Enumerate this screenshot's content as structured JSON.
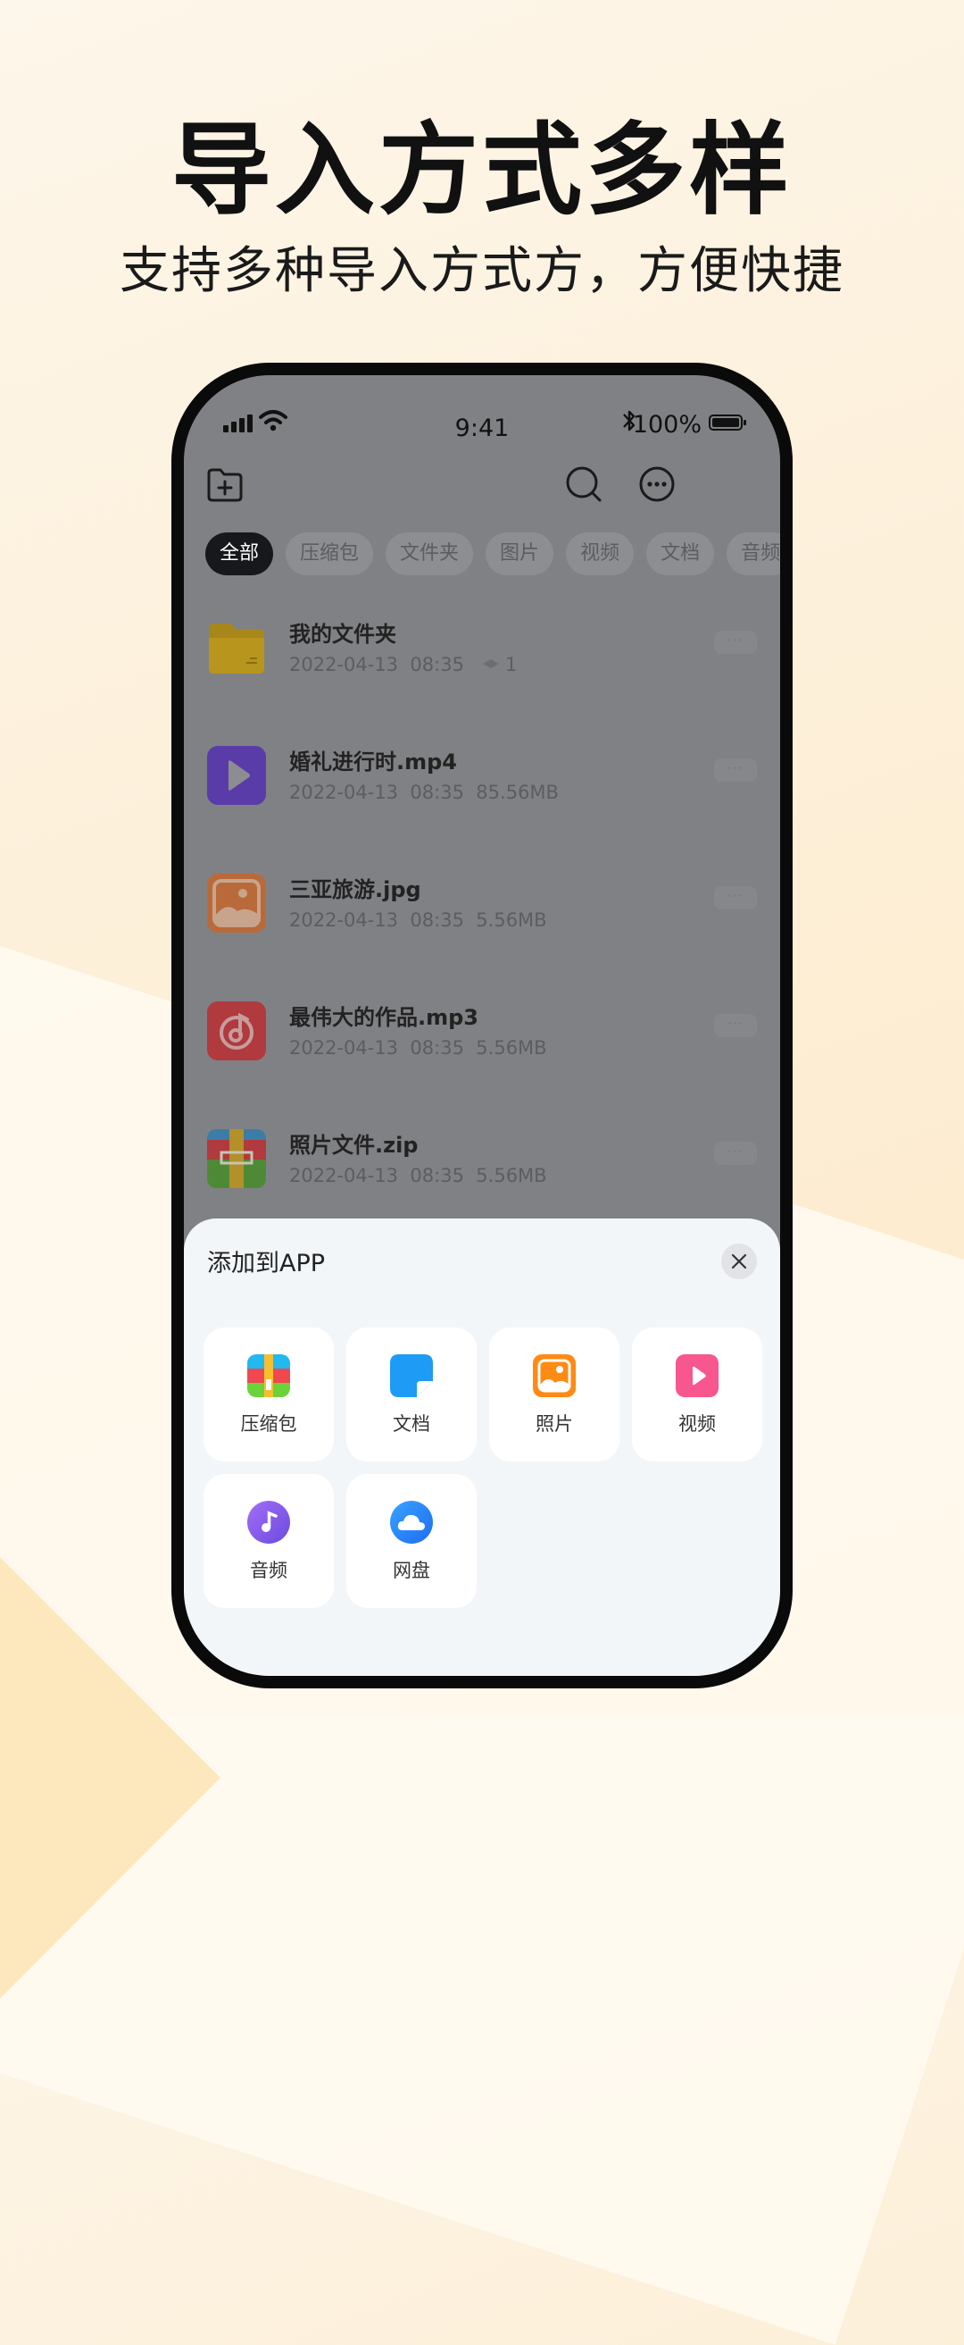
{
  "promo": {
    "headline": "导入方式多样",
    "subline": "支持多种导入方式方，方便快捷"
  },
  "status_bar": {
    "time": "9:41",
    "battery": "100%",
    "icons": [
      "signal-icon",
      "wifi-icon",
      "bluetooth-icon",
      "battery-icon"
    ]
  },
  "toolbar": {
    "icons": [
      "new-folder-icon",
      "search-icon",
      "more-icon"
    ]
  },
  "filters": [
    {
      "label": "全部",
      "active": true
    },
    {
      "label": "压缩包",
      "active": false
    },
    {
      "label": "文件夹",
      "active": false
    },
    {
      "label": "图片",
      "active": false
    },
    {
      "label": "视频",
      "active": false
    },
    {
      "label": "文档",
      "active": false
    },
    {
      "label": "音频",
      "active": false
    }
  ],
  "files": [
    {
      "name": "我的文件夹",
      "date": "2022-04-13",
      "time": "08:35",
      "size": "",
      "count": "1",
      "icon": "folder-icon",
      "color": "#b8951c"
    },
    {
      "name": "婚礼进行时.mp4",
      "date": "2022-04-13",
      "time": "08:35",
      "size": "85.56MB",
      "icon": "video-file-icon",
      "color": "#5a3ca8"
    },
    {
      "name": "三亚旅游.jpg",
      "date": "2022-04-13",
      "time": "08:35",
      "size": "5.56MB",
      "icon": "image-file-icon",
      "color": "#b96a3a"
    },
    {
      "name": "最伟大的作品.mp3",
      "date": "2022-04-13",
      "time": "08:35",
      "size": "5.56MB",
      "icon": "audio-file-icon",
      "color": "#b03a3e"
    },
    {
      "name": "照片文件.zip",
      "date": "2022-04-13",
      "time": "08:35",
      "size": "5.56MB",
      "icon": "zip-file-icon",
      "color": "#3c7da8"
    }
  ],
  "row_more": "···",
  "sheet": {
    "title": "添加到APP",
    "options": [
      {
        "label": "压缩包",
        "icon": "archive-icon"
      },
      {
        "label": "文档",
        "icon": "document-icon"
      },
      {
        "label": "照片",
        "icon": "photo-icon"
      },
      {
        "label": "视频",
        "icon": "video-icon"
      },
      {
        "label": "音频",
        "icon": "audio-icon"
      },
      {
        "label": "网盘",
        "icon": "cloud-drive-icon"
      }
    ]
  },
  "colors": {
    "accent_dark": "#16181c",
    "overlay": "#808185",
    "sheet_bg": "#f3f6f9"
  }
}
